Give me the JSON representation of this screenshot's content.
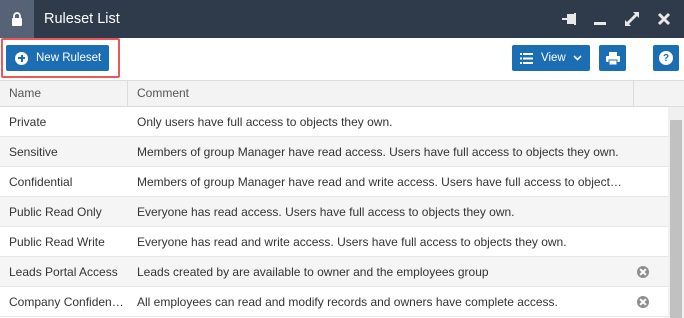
{
  "window": {
    "title": "Ruleset List"
  },
  "toolbar": {
    "new_label": "New Ruleset",
    "view_label": "View"
  },
  "table": {
    "columns": [
      "Name",
      "Comment"
    ],
    "rows": [
      {
        "name": "Private",
        "comment": "Only users have full access to objects they own.",
        "deletable": false
      },
      {
        "name": "Sensitive",
        "comment": "Members of group Manager have read access. Users have full access to objects they own.",
        "deletable": false
      },
      {
        "name": "Confidential",
        "comment": "Members of group Manager have read and write access. Users have full access to objects they own.",
        "deletable": false
      },
      {
        "name": "Public Read Only",
        "comment": "Everyone has read access. Users have full access to objects they own.",
        "deletable": false
      },
      {
        "name": "Public Read Write",
        "comment": "Everyone has read and write access. Users have full access to objects they own.",
        "deletable": false
      },
      {
        "name": "Leads Portal Access",
        "comment": "Leads created by are available to owner and the employees group",
        "deletable": true
      },
      {
        "name": "Company Confidential",
        "comment": "All employees can read and modify records and owners have complete access.",
        "deletable": true
      }
    ]
  },
  "icons": {
    "lock": "lock-icon",
    "pin": "pin-icon",
    "minimize": "minimize-icon",
    "maximize": "maximize-icon",
    "close": "close-icon",
    "add": "plus-circle-icon",
    "view": "list-icon",
    "caret": "caret-down-icon",
    "print": "printer-icon",
    "help": "help-icon",
    "delete": "remove-icon"
  },
  "colors": {
    "titlebar": "#2f3a4b",
    "primary": "#1b6eb4",
    "highlight": "#e8595b"
  }
}
